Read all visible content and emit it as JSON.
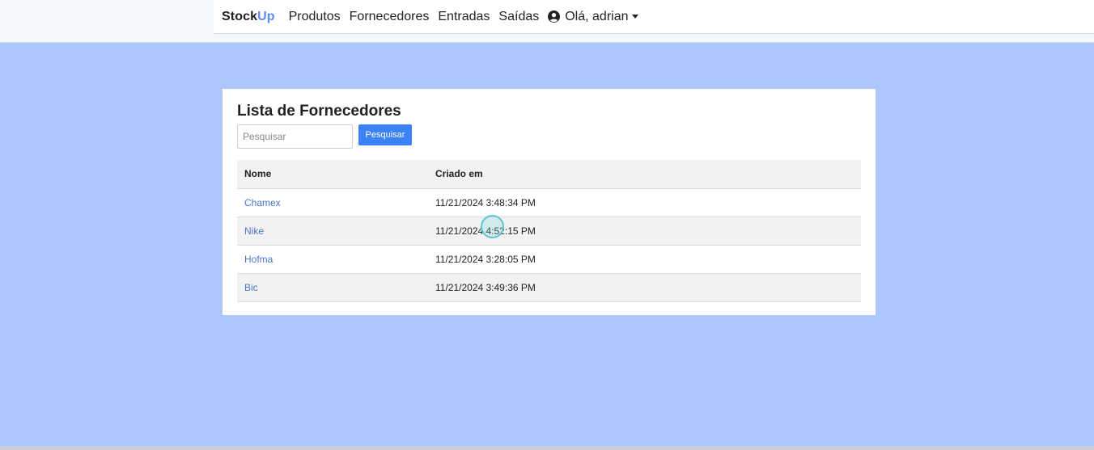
{
  "nav": {
    "brand_part1": "Stock",
    "brand_part2": "Up",
    "links": [
      "Produtos",
      "Fornecedores",
      "Entradas",
      "Saídas"
    ],
    "user_label": "Olá, adrian",
    "user_icon": "user-circle-icon"
  },
  "card": {
    "title": "Lista de Fornecedores",
    "search_placeholder": "Pesquisar",
    "search_value": "",
    "search_button": "Pesquisar"
  },
  "table": {
    "headers": [
      "Nome",
      "Criado em"
    ],
    "rows": [
      {
        "name": "Chamex",
        "created": "11/21/2024 3:48:34 PM"
      },
      {
        "name": "Nike",
        "created": "11/21/2024 4:52:15 PM"
      },
      {
        "name": "Hofma",
        "created": "11/21/2024 3:28:05 PM"
      },
      {
        "name": "Bic",
        "created": "11/21/2024 3:49:36 PM"
      }
    ]
  },
  "colors": {
    "page_background": "#adc6fb",
    "accent": "#5b8def",
    "button": "#3b82f6",
    "link": "#4a78c9"
  }
}
